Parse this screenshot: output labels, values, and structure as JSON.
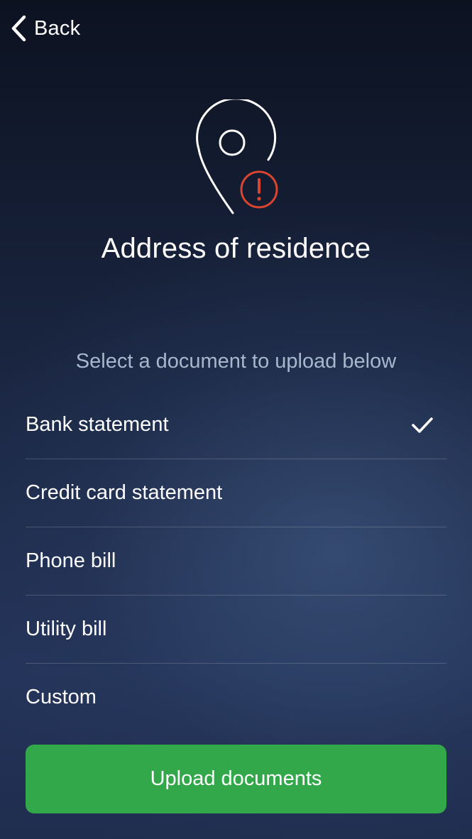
{
  "nav": {
    "back_label": "Back",
    "back_icon": "chevron-left-icon"
  },
  "hero": {
    "icon": "location-pin-warning-icon",
    "warning_glyph": "!",
    "warning_color": "#d9452f"
  },
  "page": {
    "title": "Address of residence",
    "subtitle": "Select a document to upload below"
  },
  "documents": [
    {
      "label": "Bank statement",
      "selected": true
    },
    {
      "label": "Credit card statement",
      "selected": false
    },
    {
      "label": "Phone bill",
      "selected": false
    },
    {
      "label": "Utility bill",
      "selected": false
    },
    {
      "label": "Custom",
      "selected": false
    }
  ],
  "actions": {
    "upload_label": "Upload documents",
    "upload_color": "#32a84a"
  }
}
